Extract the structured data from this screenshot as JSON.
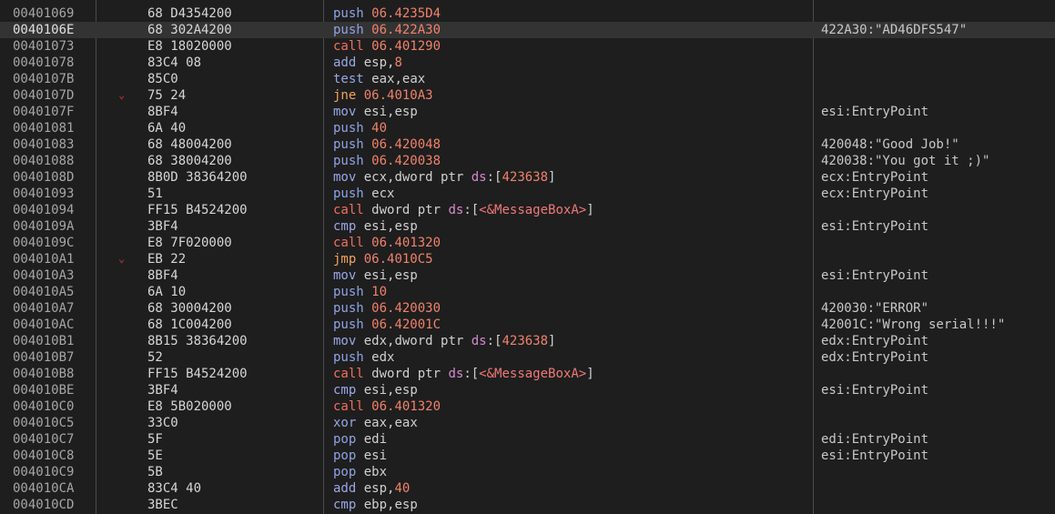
{
  "rows": [
    {
      "addr": "00401069",
      "bytes": "68 D4354200",
      "mn": "push",
      "op": "06.4235D4",
      "cm": ""
    },
    {
      "addr": "0040106E",
      "bytes": "68 302A4200",
      "mn": "push",
      "op": "06.422A30",
      "cm": "422A30:\"AD46DFS547\""
    },
    {
      "addr": "00401073",
      "bytes": "E8 18020000",
      "mn": "call",
      "op": "06.401290",
      "cm": ""
    },
    {
      "addr": "00401078",
      "bytes": "83C4 08",
      "mn": "add",
      "op": "esp,8",
      "cm": ""
    },
    {
      "addr": "0040107B",
      "bytes": "85C0",
      "mn": "test",
      "op": "eax,eax",
      "cm": ""
    },
    {
      "addr": "0040107D",
      "bytes": "75 24",
      "mn": "jne",
      "op": "06.4010A3",
      "cm": "",
      "jump": true
    },
    {
      "addr": "0040107F",
      "bytes": "8BF4",
      "mn": "mov",
      "op": "esi,esp",
      "cm": "esi:EntryPoint"
    },
    {
      "addr": "00401081",
      "bytes": "6A 40",
      "mn": "push",
      "op": "40",
      "cm": ""
    },
    {
      "addr": "00401083",
      "bytes": "68 48004200",
      "mn": "push",
      "op": "06.420048",
      "cm": "420048:\"Good Job!\""
    },
    {
      "addr": "00401088",
      "bytes": "68 38004200",
      "mn": "push",
      "op": "06.420038",
      "cm": "420038:\"You got it ;)\""
    },
    {
      "addr": "0040108D",
      "bytes": "8B0D 38364200",
      "mn": "mov",
      "op": "ecx,dword ptr ds:[423638]",
      "cm": "ecx:EntryPoint"
    },
    {
      "addr": "00401093",
      "bytes": "51",
      "mn": "push",
      "op": "ecx",
      "cm": "ecx:EntryPoint"
    },
    {
      "addr": "00401094",
      "bytes": "FF15 B4524200",
      "mn": "call",
      "op": "dword ptr ds:[<&MessageBoxA>]",
      "cm": ""
    },
    {
      "addr": "0040109A",
      "bytes": "3BF4",
      "mn": "cmp",
      "op": "esi,esp",
      "cm": "esi:EntryPoint"
    },
    {
      "addr": "0040109C",
      "bytes": "E8 7F020000",
      "mn": "call",
      "op": "06.401320",
      "cm": ""
    },
    {
      "addr": "004010A1",
      "bytes": "EB 22",
      "mn": "jmp",
      "op": "06.4010C5",
      "cm": "",
      "jump": true
    },
    {
      "addr": "004010A3",
      "bytes": "8BF4",
      "mn": "mov",
      "op": "esi,esp",
      "cm": "esi:EntryPoint"
    },
    {
      "addr": "004010A5",
      "bytes": "6A 10",
      "mn": "push",
      "op": "10",
      "cm": ""
    },
    {
      "addr": "004010A7",
      "bytes": "68 30004200",
      "mn": "push",
      "op": "06.420030",
      "cm": "420030:\"ERROR\""
    },
    {
      "addr": "004010AC",
      "bytes": "68 1C004200",
      "mn": "push",
      "op": "06.42001C",
      "cm": "42001C:\"Wrong serial!!!\""
    },
    {
      "addr": "004010B1",
      "bytes": "8B15 38364200",
      "mn": "mov",
      "op": "edx,dword ptr ds:[423638]",
      "cm": "edx:EntryPoint"
    },
    {
      "addr": "004010B7",
      "bytes": "52",
      "mn": "push",
      "op": "edx",
      "cm": "edx:EntryPoint"
    },
    {
      "addr": "004010B8",
      "bytes": "FF15 B4524200",
      "mn": "call",
      "op": "dword ptr ds:[<&MessageBoxA>]",
      "cm": ""
    },
    {
      "addr": "004010BE",
      "bytes": "3BF4",
      "mn": "cmp",
      "op": "esi,esp",
      "cm": "esi:EntryPoint"
    },
    {
      "addr": "004010C0",
      "bytes": "E8 5B020000",
      "mn": "call",
      "op": "06.401320",
      "cm": ""
    },
    {
      "addr": "004010C5",
      "bytes": "33C0",
      "mn": "xor",
      "op": "eax,eax",
      "cm": ""
    },
    {
      "addr": "004010C7",
      "bytes": "5F",
      "mn": "pop",
      "op": "edi",
      "cm": "edi:EntryPoint"
    },
    {
      "addr": "004010C8",
      "bytes": "5E",
      "mn": "pop",
      "op": "esi",
      "cm": "esi:EntryPoint"
    },
    {
      "addr": "004010C9",
      "bytes": "5B",
      "mn": "pop",
      "op": "ebx",
      "cm": ""
    },
    {
      "addr": "004010CA",
      "bytes": "83C4 40",
      "mn": "add",
      "op": "esp,40",
      "cm": ""
    },
    {
      "addr": "004010CD",
      "bytes": "3BEC",
      "mn": "cmp",
      "op": "ebp,esp",
      "cm": ""
    }
  ],
  "selected_addr": "0040106E",
  "jump_arrow_icon": "chevron-down-icon",
  "colors": {
    "background": "#1e1e1e",
    "selected_row": "#333333",
    "call": "#f26f5e",
    "jump": "#f2a25e",
    "push": "#8fa3e6",
    "immediate": "#f0826b"
  }
}
